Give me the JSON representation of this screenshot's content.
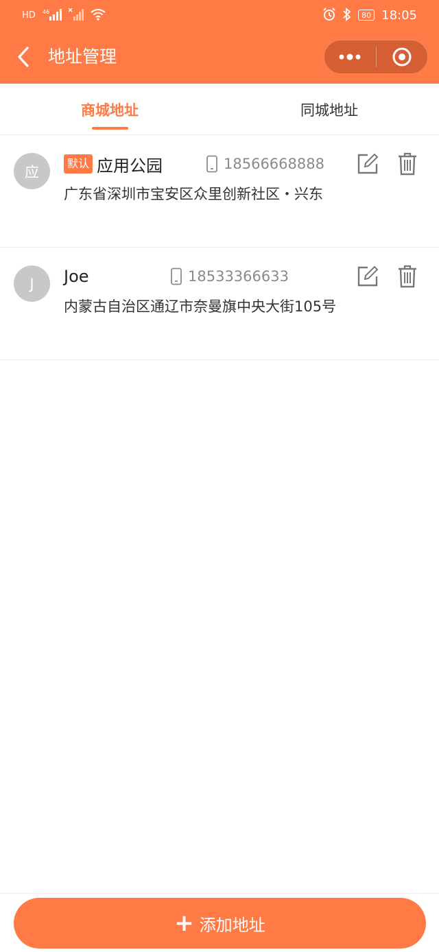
{
  "status_bar": {
    "left_icons": [
      "hd-icon",
      "signal-4g-icon",
      "signal-x-icon",
      "wifi-icon"
    ],
    "alarm_icon": "alarm-icon",
    "bluetooth_icon": "bluetooth-icon",
    "battery": "80",
    "time": "18:05",
    "hd_label": "HD",
    "net_label": "46"
  },
  "nav": {
    "title": "地址管理",
    "more_icon": "more-dots-icon",
    "close_icon": "target-icon"
  },
  "tabs": [
    {
      "label": "商城地址",
      "active": true
    },
    {
      "label": "同城地址",
      "active": false
    }
  ],
  "addresses": [
    {
      "avatar": "应",
      "default_badge": "默认",
      "name": "应用公园",
      "phone": "18566668888",
      "address": "广东省深圳市宝安区众里创新社区・兴东"
    },
    {
      "avatar": "J",
      "default_badge": "",
      "name": "Joe",
      "phone": "18533366633",
      "address": "内蒙古自治区通辽市奈曼旗中央大街105号"
    }
  ],
  "bottom": {
    "add_label": "添加地址"
  },
  "colors": {
    "accent": "#FF7A45",
    "avatar_bg": "#C8C8C8",
    "text": "#333333",
    "muted": "#8A8A8A"
  }
}
